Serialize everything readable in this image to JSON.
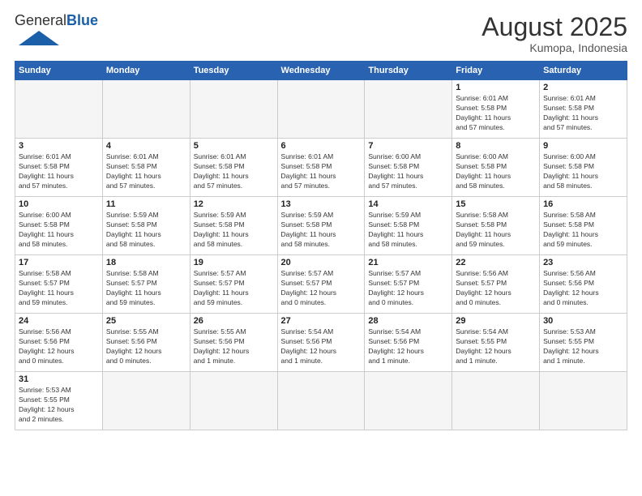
{
  "header": {
    "logo_general": "General",
    "logo_blue": "Blue",
    "month_year": "August 2025",
    "location": "Kumopa, Indonesia"
  },
  "weekdays": [
    "Sunday",
    "Monday",
    "Tuesday",
    "Wednesday",
    "Thursday",
    "Friday",
    "Saturday"
  ],
  "weeks": [
    [
      {
        "day": "",
        "info": ""
      },
      {
        "day": "",
        "info": ""
      },
      {
        "day": "",
        "info": ""
      },
      {
        "day": "",
        "info": ""
      },
      {
        "day": "",
        "info": ""
      },
      {
        "day": "1",
        "info": "Sunrise: 6:01 AM\nSunset: 5:58 PM\nDaylight: 11 hours\nand 57 minutes."
      },
      {
        "day": "2",
        "info": "Sunrise: 6:01 AM\nSunset: 5:58 PM\nDaylight: 11 hours\nand 57 minutes."
      }
    ],
    [
      {
        "day": "3",
        "info": "Sunrise: 6:01 AM\nSunset: 5:58 PM\nDaylight: 11 hours\nand 57 minutes."
      },
      {
        "day": "4",
        "info": "Sunrise: 6:01 AM\nSunset: 5:58 PM\nDaylight: 11 hours\nand 57 minutes."
      },
      {
        "day": "5",
        "info": "Sunrise: 6:01 AM\nSunset: 5:58 PM\nDaylight: 11 hours\nand 57 minutes."
      },
      {
        "day": "6",
        "info": "Sunrise: 6:01 AM\nSunset: 5:58 PM\nDaylight: 11 hours\nand 57 minutes."
      },
      {
        "day": "7",
        "info": "Sunrise: 6:00 AM\nSunset: 5:58 PM\nDaylight: 11 hours\nand 57 minutes."
      },
      {
        "day": "8",
        "info": "Sunrise: 6:00 AM\nSunset: 5:58 PM\nDaylight: 11 hours\nand 58 minutes."
      },
      {
        "day": "9",
        "info": "Sunrise: 6:00 AM\nSunset: 5:58 PM\nDaylight: 11 hours\nand 58 minutes."
      }
    ],
    [
      {
        "day": "10",
        "info": "Sunrise: 6:00 AM\nSunset: 5:58 PM\nDaylight: 11 hours\nand 58 minutes."
      },
      {
        "day": "11",
        "info": "Sunrise: 5:59 AM\nSunset: 5:58 PM\nDaylight: 11 hours\nand 58 minutes."
      },
      {
        "day": "12",
        "info": "Sunrise: 5:59 AM\nSunset: 5:58 PM\nDaylight: 11 hours\nand 58 minutes."
      },
      {
        "day": "13",
        "info": "Sunrise: 5:59 AM\nSunset: 5:58 PM\nDaylight: 11 hours\nand 58 minutes."
      },
      {
        "day": "14",
        "info": "Sunrise: 5:59 AM\nSunset: 5:58 PM\nDaylight: 11 hours\nand 58 minutes."
      },
      {
        "day": "15",
        "info": "Sunrise: 5:58 AM\nSunset: 5:58 PM\nDaylight: 11 hours\nand 59 minutes."
      },
      {
        "day": "16",
        "info": "Sunrise: 5:58 AM\nSunset: 5:58 PM\nDaylight: 11 hours\nand 59 minutes."
      }
    ],
    [
      {
        "day": "17",
        "info": "Sunrise: 5:58 AM\nSunset: 5:57 PM\nDaylight: 11 hours\nand 59 minutes."
      },
      {
        "day": "18",
        "info": "Sunrise: 5:58 AM\nSunset: 5:57 PM\nDaylight: 11 hours\nand 59 minutes."
      },
      {
        "day": "19",
        "info": "Sunrise: 5:57 AM\nSunset: 5:57 PM\nDaylight: 11 hours\nand 59 minutes."
      },
      {
        "day": "20",
        "info": "Sunrise: 5:57 AM\nSunset: 5:57 PM\nDaylight: 12 hours\nand 0 minutes."
      },
      {
        "day": "21",
        "info": "Sunrise: 5:57 AM\nSunset: 5:57 PM\nDaylight: 12 hours\nand 0 minutes."
      },
      {
        "day": "22",
        "info": "Sunrise: 5:56 AM\nSunset: 5:57 PM\nDaylight: 12 hours\nand 0 minutes."
      },
      {
        "day": "23",
        "info": "Sunrise: 5:56 AM\nSunset: 5:56 PM\nDaylight: 12 hours\nand 0 minutes."
      }
    ],
    [
      {
        "day": "24",
        "info": "Sunrise: 5:56 AM\nSunset: 5:56 PM\nDaylight: 12 hours\nand 0 minutes."
      },
      {
        "day": "25",
        "info": "Sunrise: 5:55 AM\nSunset: 5:56 PM\nDaylight: 12 hours\nand 0 minutes."
      },
      {
        "day": "26",
        "info": "Sunrise: 5:55 AM\nSunset: 5:56 PM\nDaylight: 12 hours\nand 1 minute."
      },
      {
        "day": "27",
        "info": "Sunrise: 5:54 AM\nSunset: 5:56 PM\nDaylight: 12 hours\nand 1 minute."
      },
      {
        "day": "28",
        "info": "Sunrise: 5:54 AM\nSunset: 5:56 PM\nDaylight: 12 hours\nand 1 minute."
      },
      {
        "day": "29",
        "info": "Sunrise: 5:54 AM\nSunset: 5:55 PM\nDaylight: 12 hours\nand 1 minute."
      },
      {
        "day": "30",
        "info": "Sunrise: 5:53 AM\nSunset: 5:55 PM\nDaylight: 12 hours\nand 1 minute."
      }
    ],
    [
      {
        "day": "31",
        "info": "Sunrise: 5:53 AM\nSunset: 5:55 PM\nDaylight: 12 hours\nand 2 minutes."
      },
      {
        "day": "",
        "info": ""
      },
      {
        "day": "",
        "info": ""
      },
      {
        "day": "",
        "info": ""
      },
      {
        "day": "",
        "info": ""
      },
      {
        "day": "",
        "info": ""
      },
      {
        "day": "",
        "info": ""
      }
    ]
  ]
}
